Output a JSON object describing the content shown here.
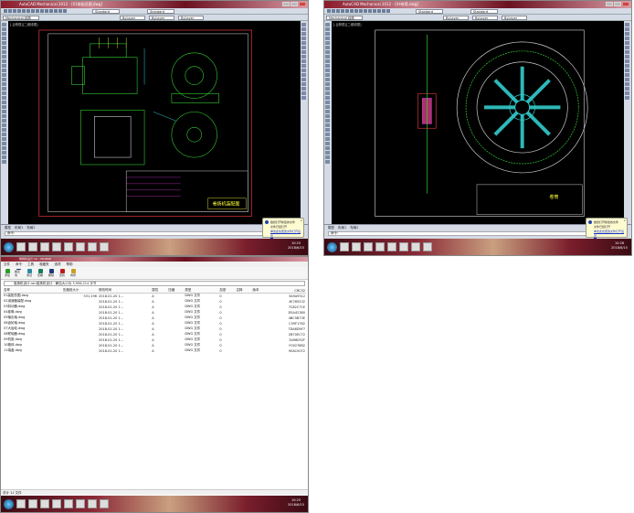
{
  "cad_windows": [
    {
      "title": "AutoCAD Mechanical 2012 - [01装配总图.dwg]",
      "workspace": "Mechanical 经典",
      "style": "Standard",
      "layer": "ByLayer",
      "tab": "[-][俯视][二维线框]",
      "cmd_tabs": [
        "模型",
        "布局1",
        "布局2"
      ],
      "command": "命令:",
      "balloon": {
        "title": "始终打开新建的文件",
        "body": "文件已经打开",
        "link": "单击此处更改文件打开设置"
      },
      "clock": {
        "time": "10:25",
        "date": "2018/6/15"
      },
      "title_block": "卷扬机装配图"
    },
    {
      "title": "AutoCAD Mechanical 2012 - [04卷筒.dwg]",
      "workspace": "Mechanical 经典",
      "style": "Standard",
      "layer": "ByLayer",
      "tab": "[-][俯视][二维线框]",
      "cmd_tabs": [
        "模型",
        "布局1",
        "布局2"
      ],
      "command": "命令:",
      "balloon": {
        "title": "始终打开新建的文件",
        "body": "文件已经打开",
        "link": "单击此处更改文件打开设置"
      },
      "clock": {
        "time": "10:26",
        "date": "2018/6/15"
      },
      "title_block": "卷筒"
    }
  ],
  "file_manager": {
    "title": "卷扬机设计.rar - WinRAR",
    "menu": [
      "文件",
      "命令",
      "工具",
      "收藏夹",
      "选项",
      "帮助"
    ],
    "toolbar": [
      "添加",
      "解压到",
      "测试",
      "查看",
      "删除",
      "查找",
      "向导"
    ],
    "toolbar_colors": [
      "#2a9a2a",
      "#1c3a8c",
      "#2a8aa0",
      "#1a7a5a",
      "#1a3a7a",
      "#c01818",
      "#c8a020"
    ],
    "address": "卷扬机设计.rar\\卷扬机设计 - 解包大小为 3,956,214 字节",
    "columns": [
      "名称",
      "压缩前大小",
      "修改时间",
      "属性",
      "压缩",
      "类型",
      "加密",
      "注释",
      "版本",
      "CRC32"
    ],
    "files": [
      {
        "name": "01装配总图.dwg",
        "size": "531,196",
        "modified": "2018-01-20 1...",
        "attr": "A",
        "type": "DWG 文件",
        "ver": "0",
        "crc": "3A9A9312"
      },
      {
        "name": "02减速器装配.dwg",
        "size": "",
        "modified": "2018-01-20 1...",
        "attr": "A",
        "type": "DWG 文件",
        "ver": "0",
        "crc": "4E765232"
      },
      {
        "name": "03制动器.dwg",
        "size": "",
        "modified": "2018-01-20 1...",
        "attr": "A",
        "type": "DWG 文件",
        "ver": "0",
        "crc": "7C82C71E"
      },
      {
        "name": "04卷筒.dwg",
        "size": "",
        "modified": "2018-01-20 1...",
        "attr": "A",
        "type": "DWG 文件",
        "ver": "0",
        "crc": "D5A42380"
      },
      {
        "name": "05输出轴.dwg",
        "size": "",
        "modified": "2018-01-20 1...",
        "attr": "A",
        "type": "DWG 文件",
        "ver": "0",
        "crc": "4BC5B73E"
      },
      {
        "name": "06齿轮轴.dwg",
        "size": "",
        "modified": "2018-01-20 1...",
        "attr": "A",
        "type": "DWG 文件",
        "ver": "0",
        "crc": "C59F1782"
      },
      {
        "name": "07大齿轮.dwg",
        "size": "",
        "modified": "2018-01-20 1...",
        "attr": "A",
        "type": "DWG 文件",
        "ver": "0",
        "crc": "7DA6D9F7"
      },
      {
        "name": "08联轴器.dwg",
        "size": "",
        "modified": "2018-01-20 1...",
        "attr": "A",
        "type": "DWG 文件",
        "ver": "0",
        "crc": "2B70EC72"
      },
      {
        "name": "09机座.dwg",
        "size": "",
        "modified": "2018-01-20 1...",
        "attr": "A",
        "type": "DWG 文件",
        "ver": "0",
        "crc": "3A98052F"
      },
      {
        "name": "10箱体.dwg",
        "size": "",
        "modified": "2018-01-20 1...",
        "attr": "A",
        "type": "DWG 文件",
        "ver": "0",
        "crc": "F0027882"
      },
      {
        "name": "11端盖.dwg",
        "size": "",
        "modified": "2018-01-20 1...",
        "attr": "A",
        "type": "DWG 文件",
        "ver": "0",
        "crc": "90AC0072"
      }
    ],
    "status": "总计 11 文件",
    "clock": {
      "time": "10:25",
      "date": "2018/6/15"
    }
  }
}
